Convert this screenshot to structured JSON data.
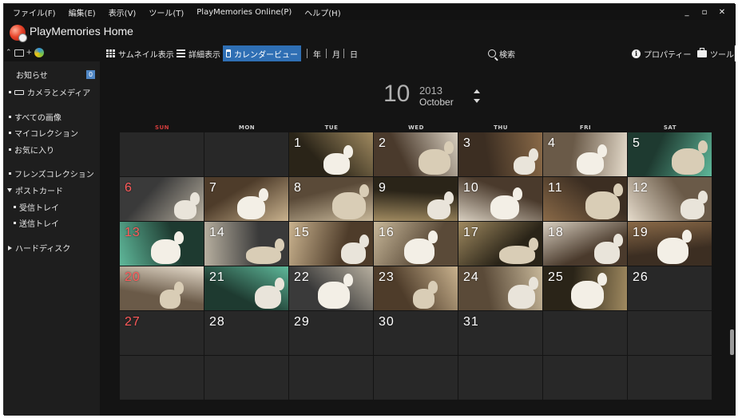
{
  "menu": {
    "items": [
      "ファイル(F)",
      "編集(E)",
      "表示(V)",
      "ツール(T)",
      "PlayMemories Online(P)",
      "ヘルプ(H)"
    ],
    "window_controls": [
      "_",
      "▫",
      "✕"
    ]
  },
  "app": {
    "title": "PlayMemories Home"
  },
  "toolbar": {
    "thumbnail_view": "サムネイル表示",
    "detail_view": "詳細表示",
    "calendar_view": "カレンダービュー",
    "year": "年",
    "month": "月",
    "day": "日",
    "search": "検索",
    "properties": "プロパティー",
    "tools": "ツール",
    "plus": "+"
  },
  "sidebar": {
    "notice": "お知らせ",
    "notice_count": "0",
    "camera_media": "カメラとメディア",
    "all_images": "すべての画像",
    "my_collection": "マイコレクション",
    "favorites": "お気に入り",
    "friends_collection": "フレンズコレクション",
    "postcard": "ポストカード",
    "inbox": "受信トレイ",
    "outbox": "送信トレイ",
    "hard_disk": "ハードディスク"
  },
  "calendar": {
    "month_number": "10",
    "year": "2013",
    "month_name": "October",
    "weekdays": [
      "SUN",
      "MON",
      "TUE",
      "WED",
      "THU",
      "FRI",
      "SAT"
    ],
    "first_weekday_index": 2,
    "days_in_month": 31,
    "days_with_photos": [
      1,
      2,
      3,
      4,
      5,
      6,
      7,
      8,
      9,
      10,
      11,
      12,
      13,
      14,
      15,
      16,
      17,
      18,
      19,
      20,
      21,
      22,
      23,
      24,
      25
    ],
    "sunday_color": "#ff5a5a"
  },
  "colors": {
    "accent": "#2f6fb4",
    "background": "#141414",
    "sidebar": "#1e1e1e",
    "cell": "#282828"
  }
}
